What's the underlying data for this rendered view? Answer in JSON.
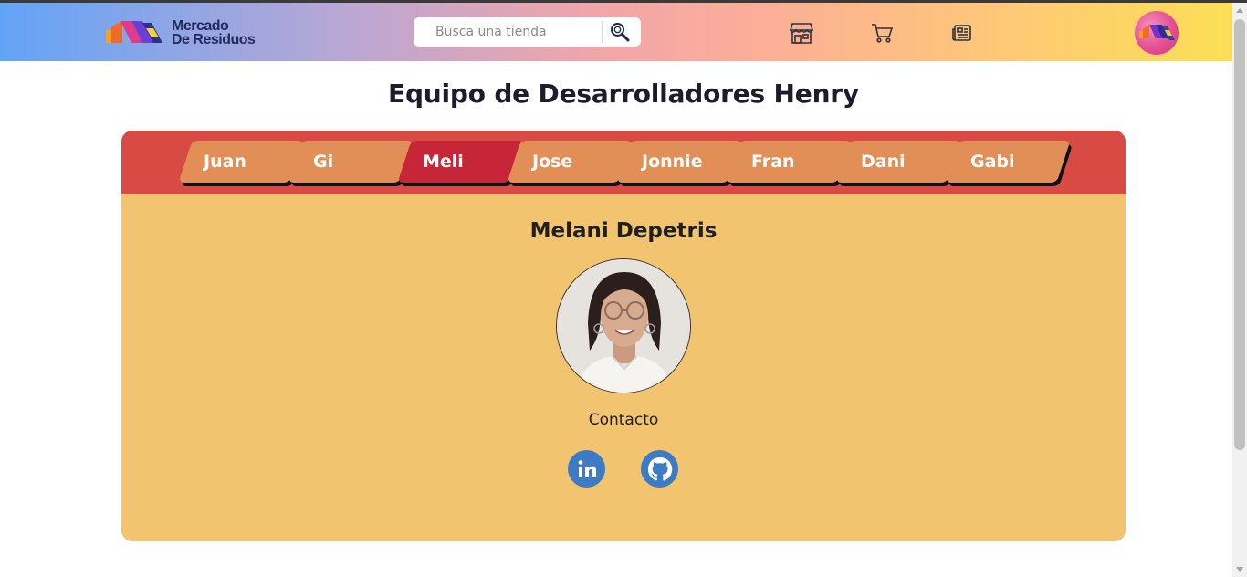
{
  "header": {
    "logo_line1": "Mercado",
    "logo_line2": "De Residuos",
    "search_placeholder": "Busca una tienda",
    "icons": [
      "store-icon",
      "cart-icon",
      "news-icon"
    ]
  },
  "page": {
    "title": "Equipo de Desarrolladores Henry"
  },
  "tabs": [
    {
      "label": "Juan",
      "active": false
    },
    {
      "label": "Gi",
      "active": false
    },
    {
      "label": "Meli",
      "active": true
    },
    {
      "label": "Jose",
      "active": false
    },
    {
      "label": "Jonnie",
      "active": false
    },
    {
      "label": "Fran",
      "active": false
    },
    {
      "label": "Dani",
      "active": false
    },
    {
      "label": "Gabi",
      "active": false
    }
  ],
  "profile": {
    "name": "Melani Depetris",
    "contact_label": "Contacto",
    "social": [
      "linkedin-icon",
      "github-icon"
    ]
  },
  "colors": {
    "tabbar": "#d84b44",
    "tab": "#e18f57",
    "tab_active": "#c62637",
    "card": "#f2c46f",
    "social": "#3d7bc6"
  }
}
